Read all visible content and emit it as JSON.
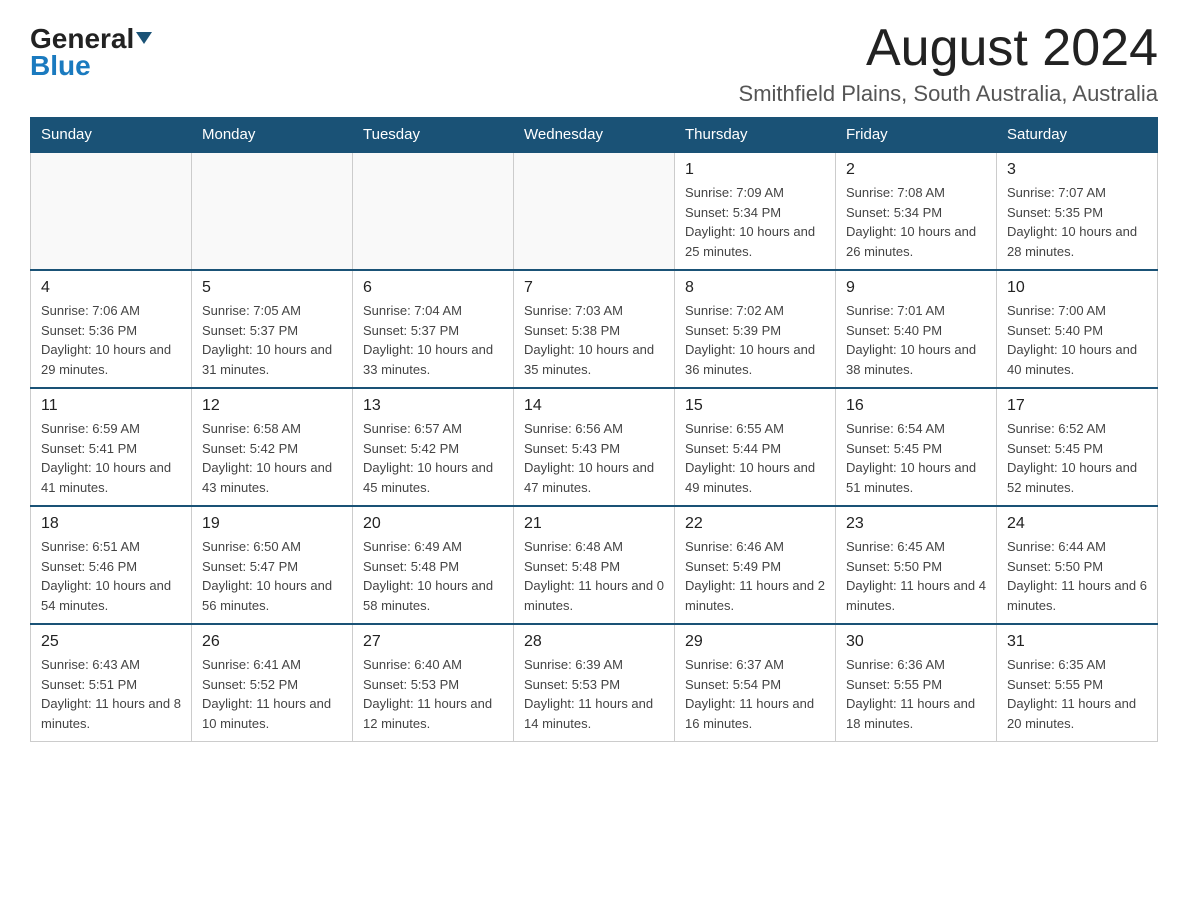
{
  "logo": {
    "general": "General",
    "blue": "Blue"
  },
  "title": {
    "month": "August 2024",
    "location": "Smithfield Plains, South Australia, Australia"
  },
  "weekdays": [
    "Sunday",
    "Monday",
    "Tuesday",
    "Wednesday",
    "Thursday",
    "Friday",
    "Saturday"
  ],
  "weeks": [
    [
      {
        "day": "",
        "info": ""
      },
      {
        "day": "",
        "info": ""
      },
      {
        "day": "",
        "info": ""
      },
      {
        "day": "",
        "info": ""
      },
      {
        "day": "1",
        "info": "Sunrise: 7:09 AM\nSunset: 5:34 PM\nDaylight: 10 hours and 25 minutes."
      },
      {
        "day": "2",
        "info": "Sunrise: 7:08 AM\nSunset: 5:34 PM\nDaylight: 10 hours and 26 minutes."
      },
      {
        "day": "3",
        "info": "Sunrise: 7:07 AM\nSunset: 5:35 PM\nDaylight: 10 hours and 28 minutes."
      }
    ],
    [
      {
        "day": "4",
        "info": "Sunrise: 7:06 AM\nSunset: 5:36 PM\nDaylight: 10 hours and 29 minutes."
      },
      {
        "day": "5",
        "info": "Sunrise: 7:05 AM\nSunset: 5:37 PM\nDaylight: 10 hours and 31 minutes."
      },
      {
        "day": "6",
        "info": "Sunrise: 7:04 AM\nSunset: 5:37 PM\nDaylight: 10 hours and 33 minutes."
      },
      {
        "day": "7",
        "info": "Sunrise: 7:03 AM\nSunset: 5:38 PM\nDaylight: 10 hours and 35 minutes."
      },
      {
        "day": "8",
        "info": "Sunrise: 7:02 AM\nSunset: 5:39 PM\nDaylight: 10 hours and 36 minutes."
      },
      {
        "day": "9",
        "info": "Sunrise: 7:01 AM\nSunset: 5:40 PM\nDaylight: 10 hours and 38 minutes."
      },
      {
        "day": "10",
        "info": "Sunrise: 7:00 AM\nSunset: 5:40 PM\nDaylight: 10 hours and 40 minutes."
      }
    ],
    [
      {
        "day": "11",
        "info": "Sunrise: 6:59 AM\nSunset: 5:41 PM\nDaylight: 10 hours and 41 minutes."
      },
      {
        "day": "12",
        "info": "Sunrise: 6:58 AM\nSunset: 5:42 PM\nDaylight: 10 hours and 43 minutes."
      },
      {
        "day": "13",
        "info": "Sunrise: 6:57 AM\nSunset: 5:42 PM\nDaylight: 10 hours and 45 minutes."
      },
      {
        "day": "14",
        "info": "Sunrise: 6:56 AM\nSunset: 5:43 PM\nDaylight: 10 hours and 47 minutes."
      },
      {
        "day": "15",
        "info": "Sunrise: 6:55 AM\nSunset: 5:44 PM\nDaylight: 10 hours and 49 minutes."
      },
      {
        "day": "16",
        "info": "Sunrise: 6:54 AM\nSunset: 5:45 PM\nDaylight: 10 hours and 51 minutes."
      },
      {
        "day": "17",
        "info": "Sunrise: 6:52 AM\nSunset: 5:45 PM\nDaylight: 10 hours and 52 minutes."
      }
    ],
    [
      {
        "day": "18",
        "info": "Sunrise: 6:51 AM\nSunset: 5:46 PM\nDaylight: 10 hours and 54 minutes."
      },
      {
        "day": "19",
        "info": "Sunrise: 6:50 AM\nSunset: 5:47 PM\nDaylight: 10 hours and 56 minutes."
      },
      {
        "day": "20",
        "info": "Sunrise: 6:49 AM\nSunset: 5:48 PM\nDaylight: 10 hours and 58 minutes."
      },
      {
        "day": "21",
        "info": "Sunrise: 6:48 AM\nSunset: 5:48 PM\nDaylight: 11 hours and 0 minutes."
      },
      {
        "day": "22",
        "info": "Sunrise: 6:46 AM\nSunset: 5:49 PM\nDaylight: 11 hours and 2 minutes."
      },
      {
        "day": "23",
        "info": "Sunrise: 6:45 AM\nSunset: 5:50 PM\nDaylight: 11 hours and 4 minutes."
      },
      {
        "day": "24",
        "info": "Sunrise: 6:44 AM\nSunset: 5:50 PM\nDaylight: 11 hours and 6 minutes."
      }
    ],
    [
      {
        "day": "25",
        "info": "Sunrise: 6:43 AM\nSunset: 5:51 PM\nDaylight: 11 hours and 8 minutes."
      },
      {
        "day": "26",
        "info": "Sunrise: 6:41 AM\nSunset: 5:52 PM\nDaylight: 11 hours and 10 minutes."
      },
      {
        "day": "27",
        "info": "Sunrise: 6:40 AM\nSunset: 5:53 PM\nDaylight: 11 hours and 12 minutes."
      },
      {
        "day": "28",
        "info": "Sunrise: 6:39 AM\nSunset: 5:53 PM\nDaylight: 11 hours and 14 minutes."
      },
      {
        "day": "29",
        "info": "Sunrise: 6:37 AM\nSunset: 5:54 PM\nDaylight: 11 hours and 16 minutes."
      },
      {
        "day": "30",
        "info": "Sunrise: 6:36 AM\nSunset: 5:55 PM\nDaylight: 11 hours and 18 minutes."
      },
      {
        "day": "31",
        "info": "Sunrise: 6:35 AM\nSunset: 5:55 PM\nDaylight: 11 hours and 20 minutes."
      }
    ]
  ]
}
